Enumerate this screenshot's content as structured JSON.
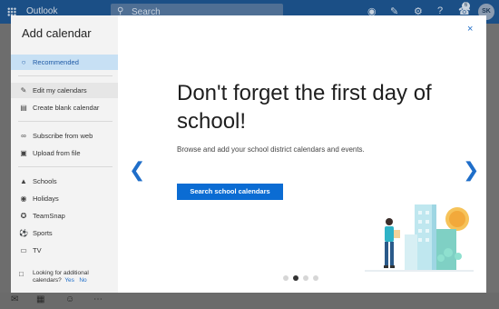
{
  "app": {
    "name": "Outlook",
    "search_placeholder": "Search",
    "avatar_initials": "SK",
    "notification_count": "6"
  },
  "dialog": {
    "title": "Add calendar",
    "nav": [
      {
        "label": "Recommended",
        "icon": "lightbulb-icon"
      },
      {
        "label": "Edit my calendars",
        "icon": "edit-icon"
      },
      {
        "label": "Create blank calendar",
        "icon": "calendar-icon"
      },
      {
        "label": "Subscribe from web",
        "icon": "link-icon"
      },
      {
        "label": "Upload from file",
        "icon": "file-icon"
      },
      {
        "label": "Schools",
        "icon": "school-icon"
      },
      {
        "label": "Holidays",
        "icon": "globe-icon"
      },
      {
        "label": "TeamSnap",
        "icon": "teamsnap-icon"
      },
      {
        "label": "Sports",
        "icon": "sports-ball-icon"
      },
      {
        "label": "TV",
        "icon": "tv-icon"
      }
    ],
    "help": {
      "question": "Looking for additional calendars?",
      "yes": "Yes",
      "no": "No"
    },
    "close_label": "×",
    "headline": "Don't forget the first day of school!",
    "subtext": "Browse and add your school district calendars and events.",
    "cta_label": "Search school calendars",
    "carousel": {
      "count": 4,
      "active_index": 1
    },
    "accent_color": "#0b6cd3"
  }
}
